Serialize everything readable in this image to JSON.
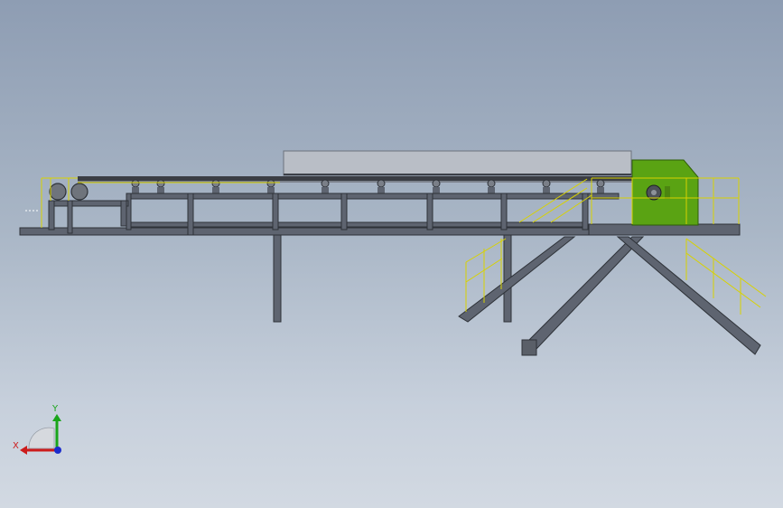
{
  "viewport": {
    "background_top": "#8e9db3",
    "background_bottom": "#d2d9e2"
  },
  "model": {
    "name": "",
    "frame_color": "#5e6470",
    "frame_edge_color": "#2e3238",
    "belt_cover_color": "#b9bec6",
    "drive_color": "#5aa313",
    "railing_color": "#d8d200",
    "roller_count": 10
  },
  "triad": {
    "x_label": "X",
    "y_label": "Y",
    "x_color": "#cc1b1b",
    "y_color": "#1aa51a",
    "z_color": "#1b2ccc",
    "icon": "coordinate-triad-icon"
  }
}
